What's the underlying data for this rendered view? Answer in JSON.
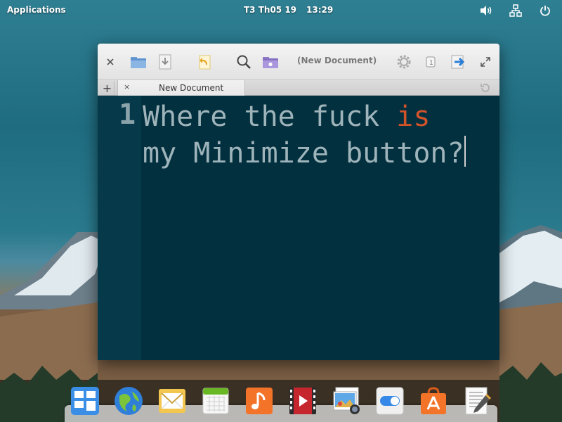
{
  "panel": {
    "applications": "Applications",
    "date": "T3 Th05 19",
    "time": "13:29",
    "icons": [
      "volume-icon",
      "network-icon",
      "power-icon"
    ]
  },
  "window": {
    "title": "(New Document)",
    "toolbar_icons": [
      "close-icon",
      "open-folder-icon",
      "save-icon",
      "revert-icon",
      "search-icon",
      "open-project-icon",
      "settings-icon",
      "share-icon",
      "fullscreen-icon"
    ]
  },
  "tabs": {
    "add": "+",
    "close": "×",
    "items": [
      {
        "label": "New Document"
      }
    ]
  },
  "editor": {
    "line_number": "1",
    "line1_before": "Where the fuck ",
    "line1_keyword": "is",
    "line2": "my Minimize button?"
  },
  "dock": {
    "apps": [
      "multitasking-view-icon",
      "web-browser-icon",
      "mail-icon",
      "calendar-icon",
      "music-icon",
      "videos-icon",
      "photos-icon",
      "system-settings-icon",
      "appcenter-icon",
      "scratch-editor-icon"
    ]
  },
  "colors": {
    "editor_bg": "#02303f",
    "gutter_bg": "#063a4a",
    "keyword": "#d1532a",
    "text": "#9fb4ba"
  }
}
